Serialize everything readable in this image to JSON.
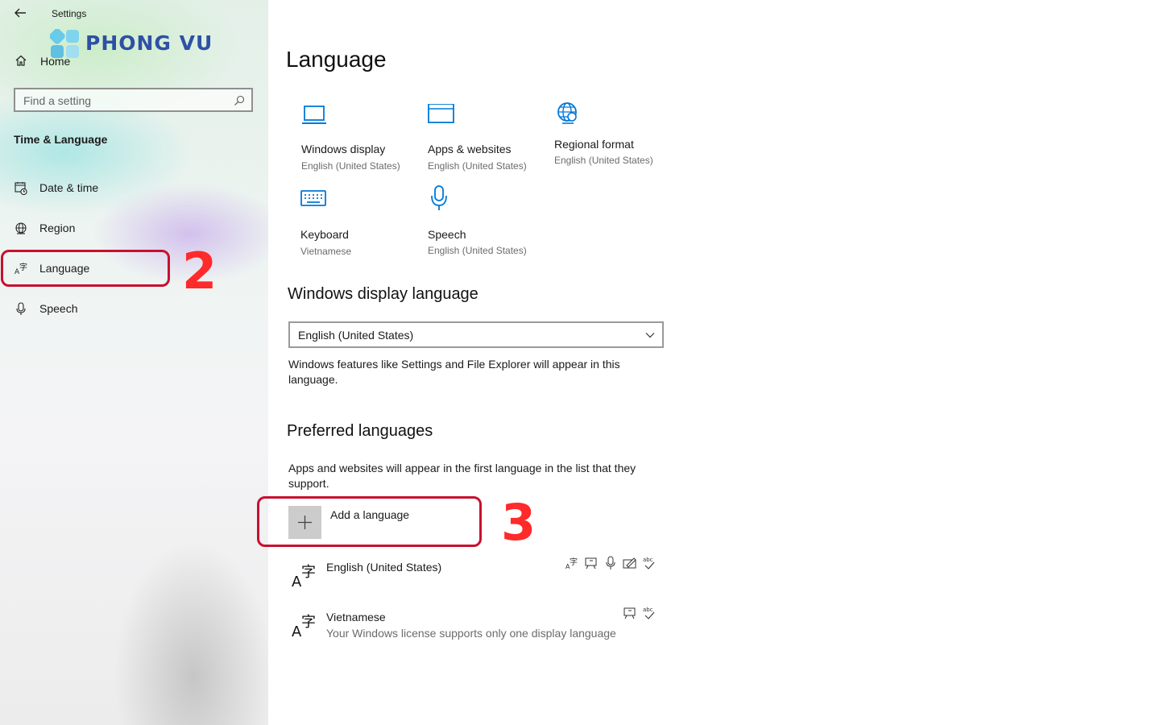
{
  "window": {
    "title": "Settings"
  },
  "watermark": {
    "brand": "PHONG VU"
  },
  "sidebar": {
    "home_label": "Home",
    "search_placeholder": "Find a setting",
    "section_title": "Time & Language",
    "items": [
      {
        "label": "Date & time",
        "icon": "calendar-clock-icon"
      },
      {
        "label": "Region",
        "icon": "globe-icon"
      },
      {
        "label": "Language",
        "icon": "language-icon",
        "selected": true
      },
      {
        "label": "Speech",
        "icon": "microphone-icon"
      }
    ]
  },
  "annotations": {
    "step2": "2",
    "step3": "3",
    "color": "#c8102e"
  },
  "main": {
    "title": "Language",
    "tiles": [
      {
        "label": "Windows display",
        "sub": "English (United States)",
        "icon": "laptop-icon"
      },
      {
        "label": "Apps & websites",
        "sub": "English (United States)",
        "icon": "window-icon"
      },
      {
        "label": "Regional format",
        "sub": "English (United States)",
        "icon": "globe-settings-icon"
      },
      {
        "label": "Keyboard",
        "sub": "Vietnamese",
        "icon": "keyboard-icon"
      },
      {
        "label": "Speech",
        "sub": "English (United States)",
        "icon": "microphone-icon"
      }
    ],
    "display_language": {
      "heading": "Windows display language",
      "selected": "English (United States)",
      "description": "Windows features like Settings and File Explorer will appear in this language."
    },
    "preferred": {
      "heading": "Preferred languages",
      "description": "Apps and websites will appear in the first language in the list that they support.",
      "add_label": "Add a language",
      "languages": [
        {
          "name": "English (United States)",
          "note": "",
          "features": [
            "display-language-icon",
            "text-to-speech-icon",
            "speech-icon",
            "handwriting-icon",
            "spellcheck-icon"
          ]
        },
        {
          "name": "Vietnamese",
          "note": "Your Windows license supports only one display language",
          "features": [
            "text-to-speech-icon",
            "spellcheck-icon"
          ]
        }
      ]
    }
  },
  "colors": {
    "accent": "#0078d7",
    "text": "#1a1a1a",
    "subtext": "#6b6b6b"
  }
}
